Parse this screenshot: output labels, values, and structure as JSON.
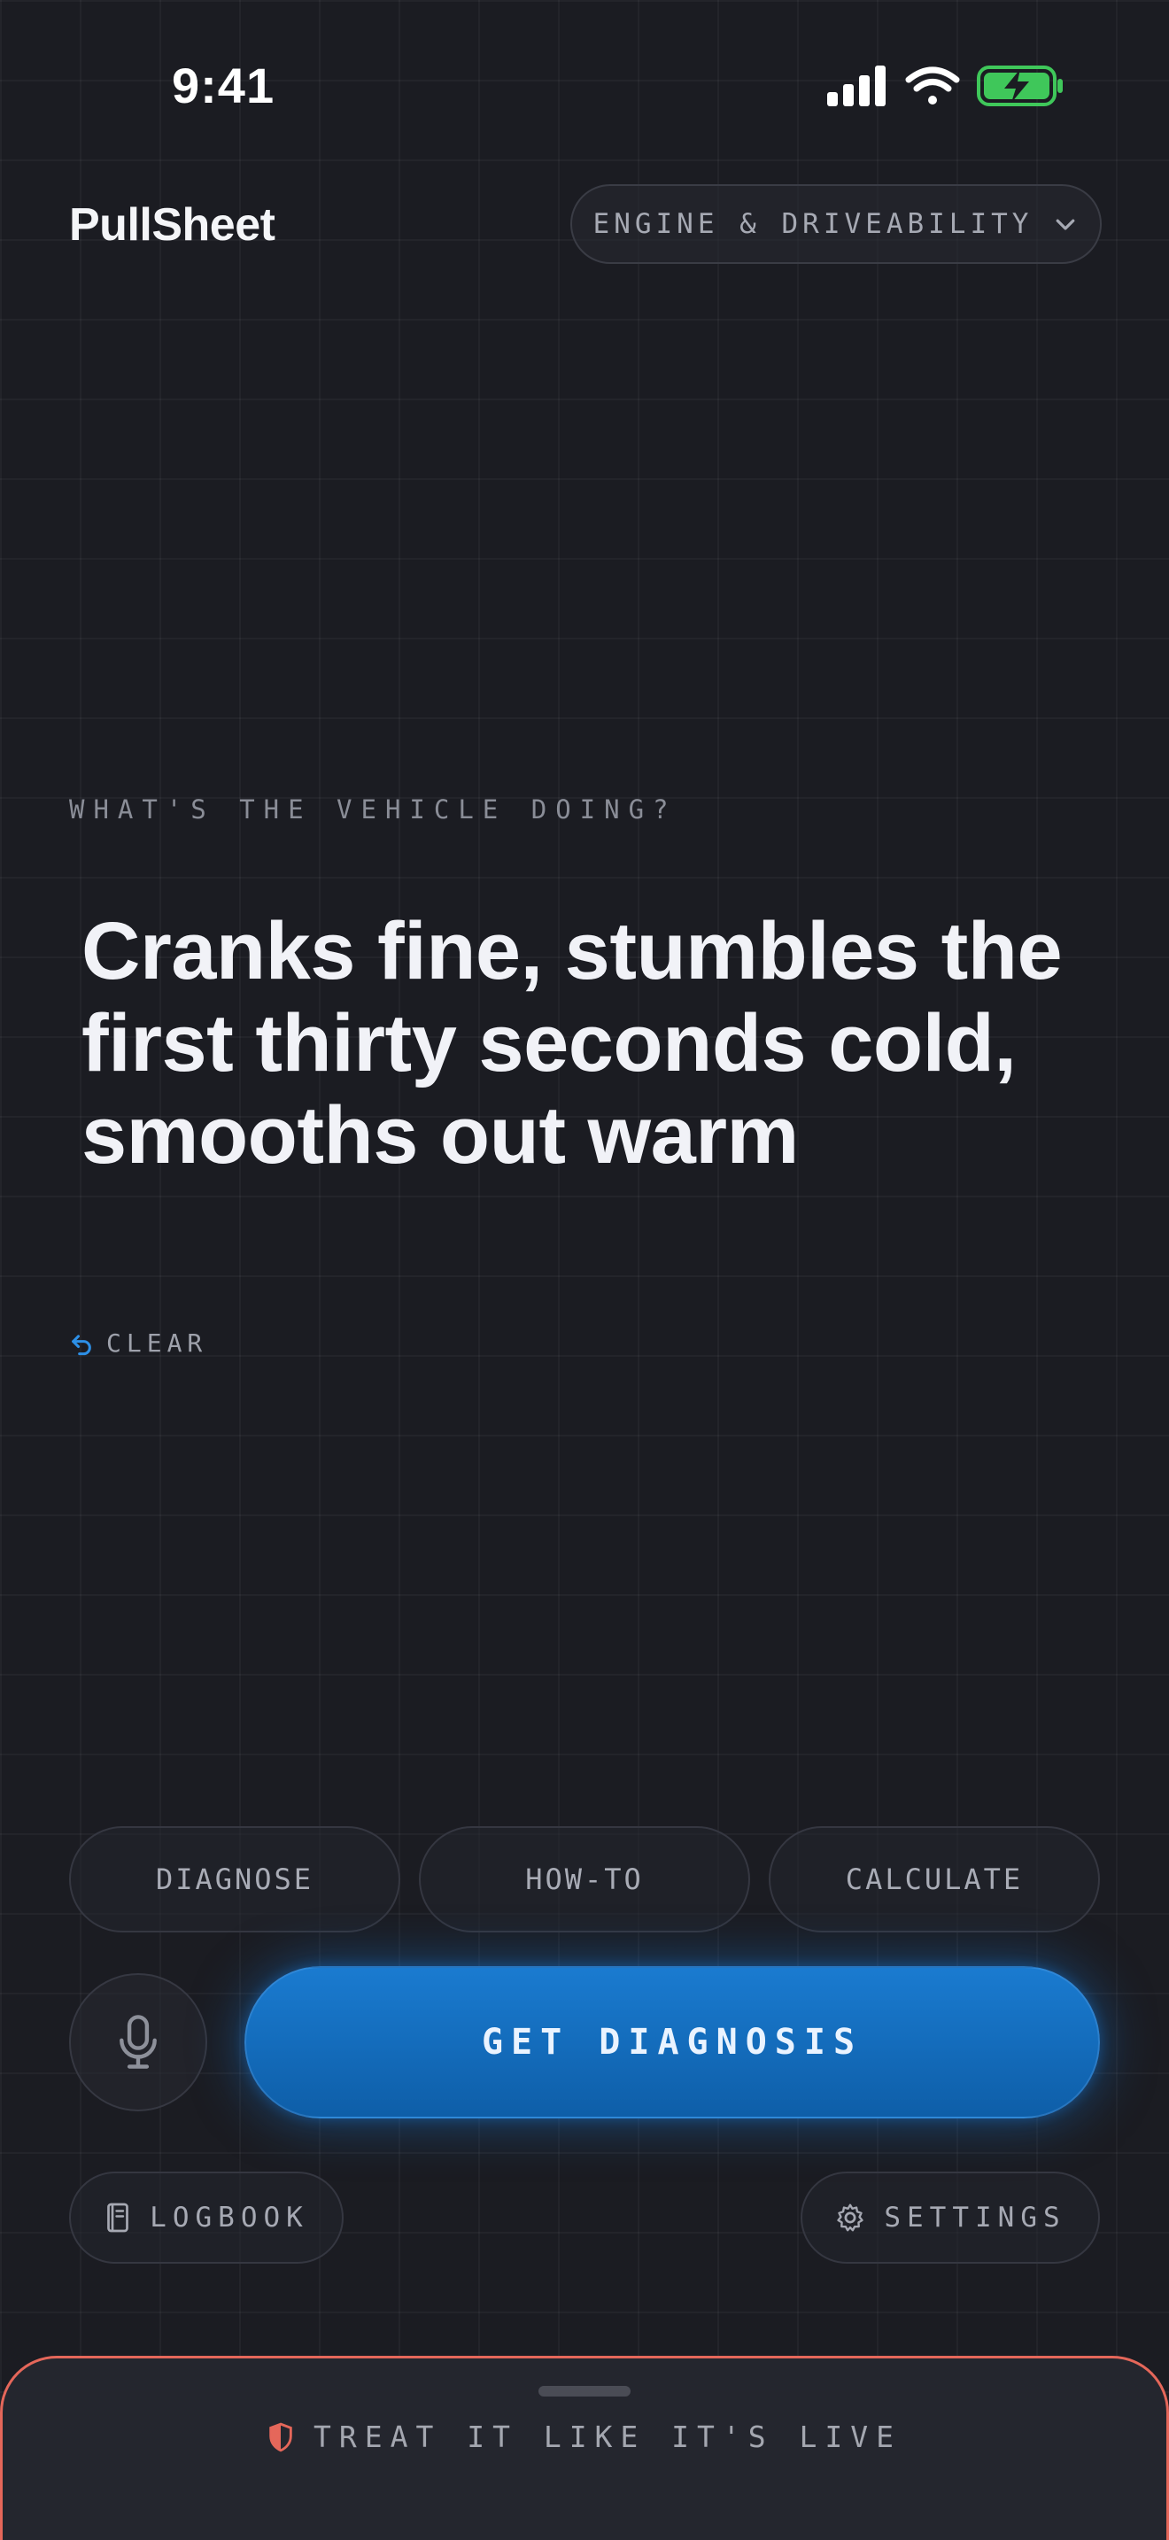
{
  "status_bar": {
    "time": "9:41"
  },
  "header": {
    "brand": "PullSheet",
    "category_select": {
      "value": "ENGINE & DRIVEABILITY",
      "icon": "chevron-down-icon"
    }
  },
  "prompt": {
    "eyebrow": "WHAT'S THE VEHICLE DOING?",
    "symptom_text": "Cranks fine, stumbles the first thirty seconds cold, smooths out warm",
    "clear_label": "CLEAR"
  },
  "modes": [
    {
      "label": "DIAGNOSE"
    },
    {
      "label": "HOW-TO"
    },
    {
      "label": "CALCULATE"
    }
  ],
  "actions": {
    "mic_icon": "microphone-icon",
    "primary_label": "GET DIAGNOSIS"
  },
  "nav": {
    "logbook_label": "LOGBOOK",
    "settings_label": "SETTINGS"
  },
  "live_sheet": {
    "title": "TREAT IT LIKE IT'S LIVE"
  },
  "colors": {
    "background": "#1b1c22",
    "accent_blue": "#1677cc",
    "warning_red": "#e5675a",
    "battery_green": "#3fc75a"
  }
}
